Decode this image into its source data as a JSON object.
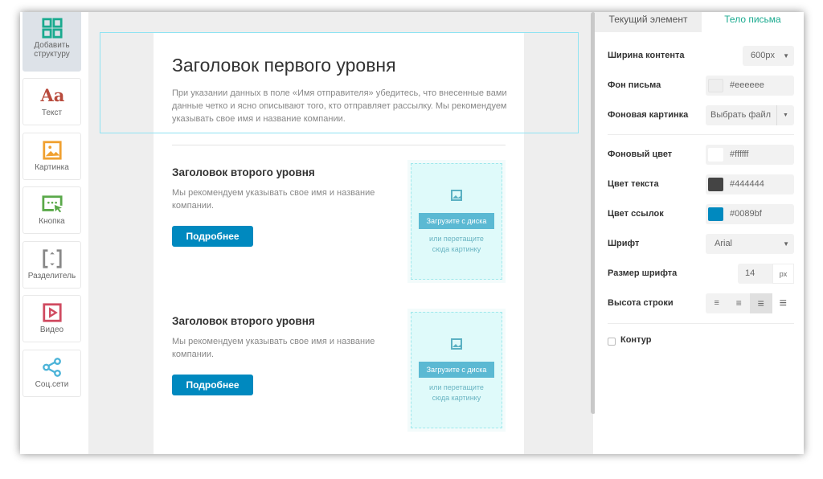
{
  "sidebar": {
    "items": [
      {
        "label": "Добавить структуру",
        "icon": "grid-icon",
        "color": "#1aaa8f"
      },
      {
        "label": "Текст",
        "icon": "text-icon",
        "color": "#b84a3c"
      },
      {
        "label": "Картинка",
        "icon": "image-icon",
        "color": "#f0a030"
      },
      {
        "label": "Кнопка",
        "icon": "button-icon",
        "color": "#5aa94a"
      },
      {
        "label": "Разделитель",
        "icon": "divider-icon",
        "color": "#888888"
      },
      {
        "label": "Видео",
        "icon": "video-icon",
        "color": "#d04a60"
      },
      {
        "label": "Соц.сети",
        "icon": "share-icon",
        "color": "#4bb3d8"
      }
    ]
  },
  "mail": {
    "h1": "Заголовок первого уровня",
    "intro": "При указании данных в поле «Имя отправителя» убедитесь, что внесенные вами данные четко и ясно описывают того, кто отправляет рассылку. Мы рекомендуем указывать свое имя и название компании.",
    "blocks": [
      {
        "h2": "Заголовок второго уровня",
        "text": "Мы рекомендуем указывать свое имя и название компании.",
        "button": "Подробнее",
        "upload": "Загрузите с диска",
        "drop": "или перетащите сюда картинку"
      },
      {
        "h2": "Заголовок второго уровня",
        "text": "Мы рекомендуем указывать свое имя и название компании.",
        "button": "Подробнее",
        "upload": "Загрузите с диска",
        "drop": "или перетащите сюда картинку"
      }
    ]
  },
  "panel": {
    "tabs": [
      "Текущий элемент",
      "Тело письма"
    ],
    "active_tab": 1,
    "content_width": {
      "label": "Ширина контента",
      "value": "600px"
    },
    "mail_bg": {
      "label": "Фон письма",
      "value": "#eeeeee"
    },
    "bg_image": {
      "label": "Фоновая картинка",
      "value": "Выбрать файл"
    },
    "bg_color": {
      "label": "Фоновый цвет",
      "value": "#ffffff"
    },
    "text_color": {
      "label": "Цвет текста",
      "value": "#444444"
    },
    "link_color": {
      "label": "Цвет ссылок",
      "value": "#0089bf"
    },
    "font": {
      "label": "Шрифт",
      "value": "Arial"
    },
    "font_size": {
      "label": "Размер шрифта",
      "value": "14",
      "unit": "px"
    },
    "line_height": {
      "label": "Высота строки",
      "selected": 3
    },
    "outline": {
      "label": "Контур",
      "checked": false
    }
  }
}
